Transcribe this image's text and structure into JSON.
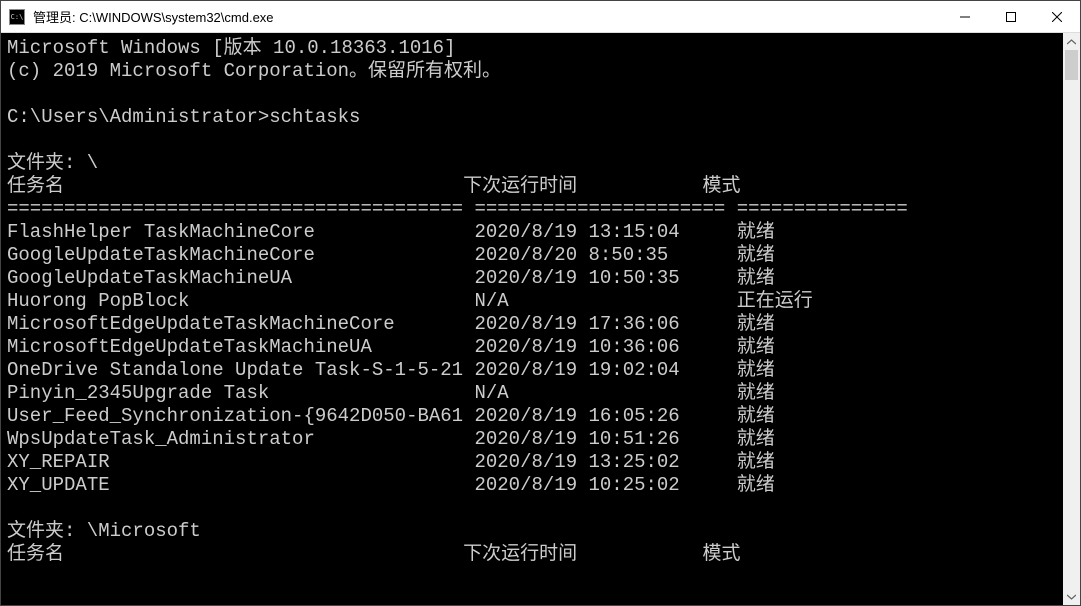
{
  "window": {
    "title": "管理员: C:\\WINDOWS\\system32\\cmd.exe",
    "icon_label": "C:\\"
  },
  "banner": {
    "line1": "Microsoft Windows [版本 10.0.18363.1016]",
    "line2": "(c) 2019 Microsoft Corporation。保留所有权利。"
  },
  "prompt": {
    "path": "C:\\Users\\Administrator>",
    "command": "schtasks"
  },
  "section1": {
    "folder_label": "文件夹: \\",
    "col_task": "任务名",
    "col_next": "下次运行时间",
    "col_mode": "模式",
    "separator": "======================================== ====================== ===============",
    "rows": [
      {
        "name": "FlashHelper TaskMachineCore",
        "next": "2020/8/19 13:15:04",
        "mode": "就绪"
      },
      {
        "name": "GoogleUpdateTaskMachineCore",
        "next": "2020/8/20 8:50:35",
        "mode": "就绪"
      },
      {
        "name": "GoogleUpdateTaskMachineUA",
        "next": "2020/8/19 10:50:35",
        "mode": "就绪"
      },
      {
        "name": "Huorong PopBlock",
        "next": "N/A",
        "mode": "正在运行"
      },
      {
        "name": "MicrosoftEdgeUpdateTaskMachineCore",
        "next": "2020/8/19 17:36:06",
        "mode": "就绪"
      },
      {
        "name": "MicrosoftEdgeUpdateTaskMachineUA",
        "next": "2020/8/19 10:36:06",
        "mode": "就绪"
      },
      {
        "name": "OneDrive Standalone Update Task-S-1-5-21",
        "next": "2020/8/19 19:02:04",
        "mode": "就绪"
      },
      {
        "name": "Pinyin_2345Upgrade Task",
        "next": "N/A",
        "mode": "就绪"
      },
      {
        "name": "User_Feed_Synchronization-{9642D050-BA61",
        "next": "2020/8/19 16:05:26",
        "mode": "就绪"
      },
      {
        "name": "WpsUpdateTask_Administrator",
        "next": "2020/8/19 10:51:26",
        "mode": "就绪"
      },
      {
        "name": "XY_REPAIR",
        "next": "2020/8/19 13:25:02",
        "mode": "就绪"
      },
      {
        "name": "XY_UPDATE",
        "next": "2020/8/19 10:25:02",
        "mode": "就绪"
      }
    ]
  },
  "section2": {
    "folder_label": "文件夹: \\Microsoft",
    "col_task": "任务名",
    "col_next": "下次运行时间",
    "col_mode": "模式"
  }
}
